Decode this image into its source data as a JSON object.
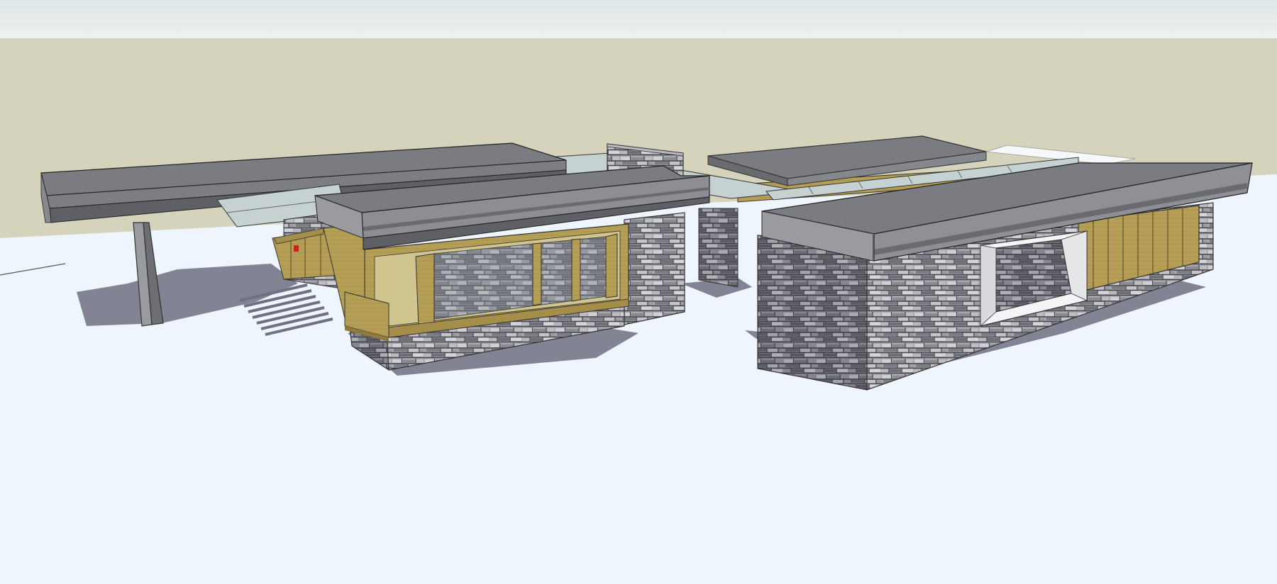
{
  "scene": {
    "kind": "3d-model-viewport",
    "style": "sketch-render",
    "colors": {
      "sky": "#e6edee",
      "horizon_band": "#d6d3bc",
      "ground": "#eef5fd",
      "roof_top": "#7b7c81",
      "roof_fascia": "#6a6b70",
      "roof_underside": "#9a9ba0",
      "stone_light": "#a7a7ad",
      "stone_dark": "#4d4d55",
      "timber": "#b59f57",
      "timber_dark": "#8e7a3e",
      "glass": "#c6d2d2",
      "window_frame_white": "#f4f5f6",
      "shadow": "#6d6e7e",
      "accent_red": "#cc2222"
    },
    "objects": [
      "sky",
      "horizon-band",
      "ground-plane",
      "west-carport-roof",
      "carport-support-column",
      "glass-skylight-walkway",
      "stone-chimney",
      "west-pavilion",
      "west-timber-window",
      "north-wing",
      "east-pavilion",
      "east-pavilion-roof",
      "framed-picture-window",
      "timber-cladding-panels",
      "ground-shadows"
    ]
  }
}
